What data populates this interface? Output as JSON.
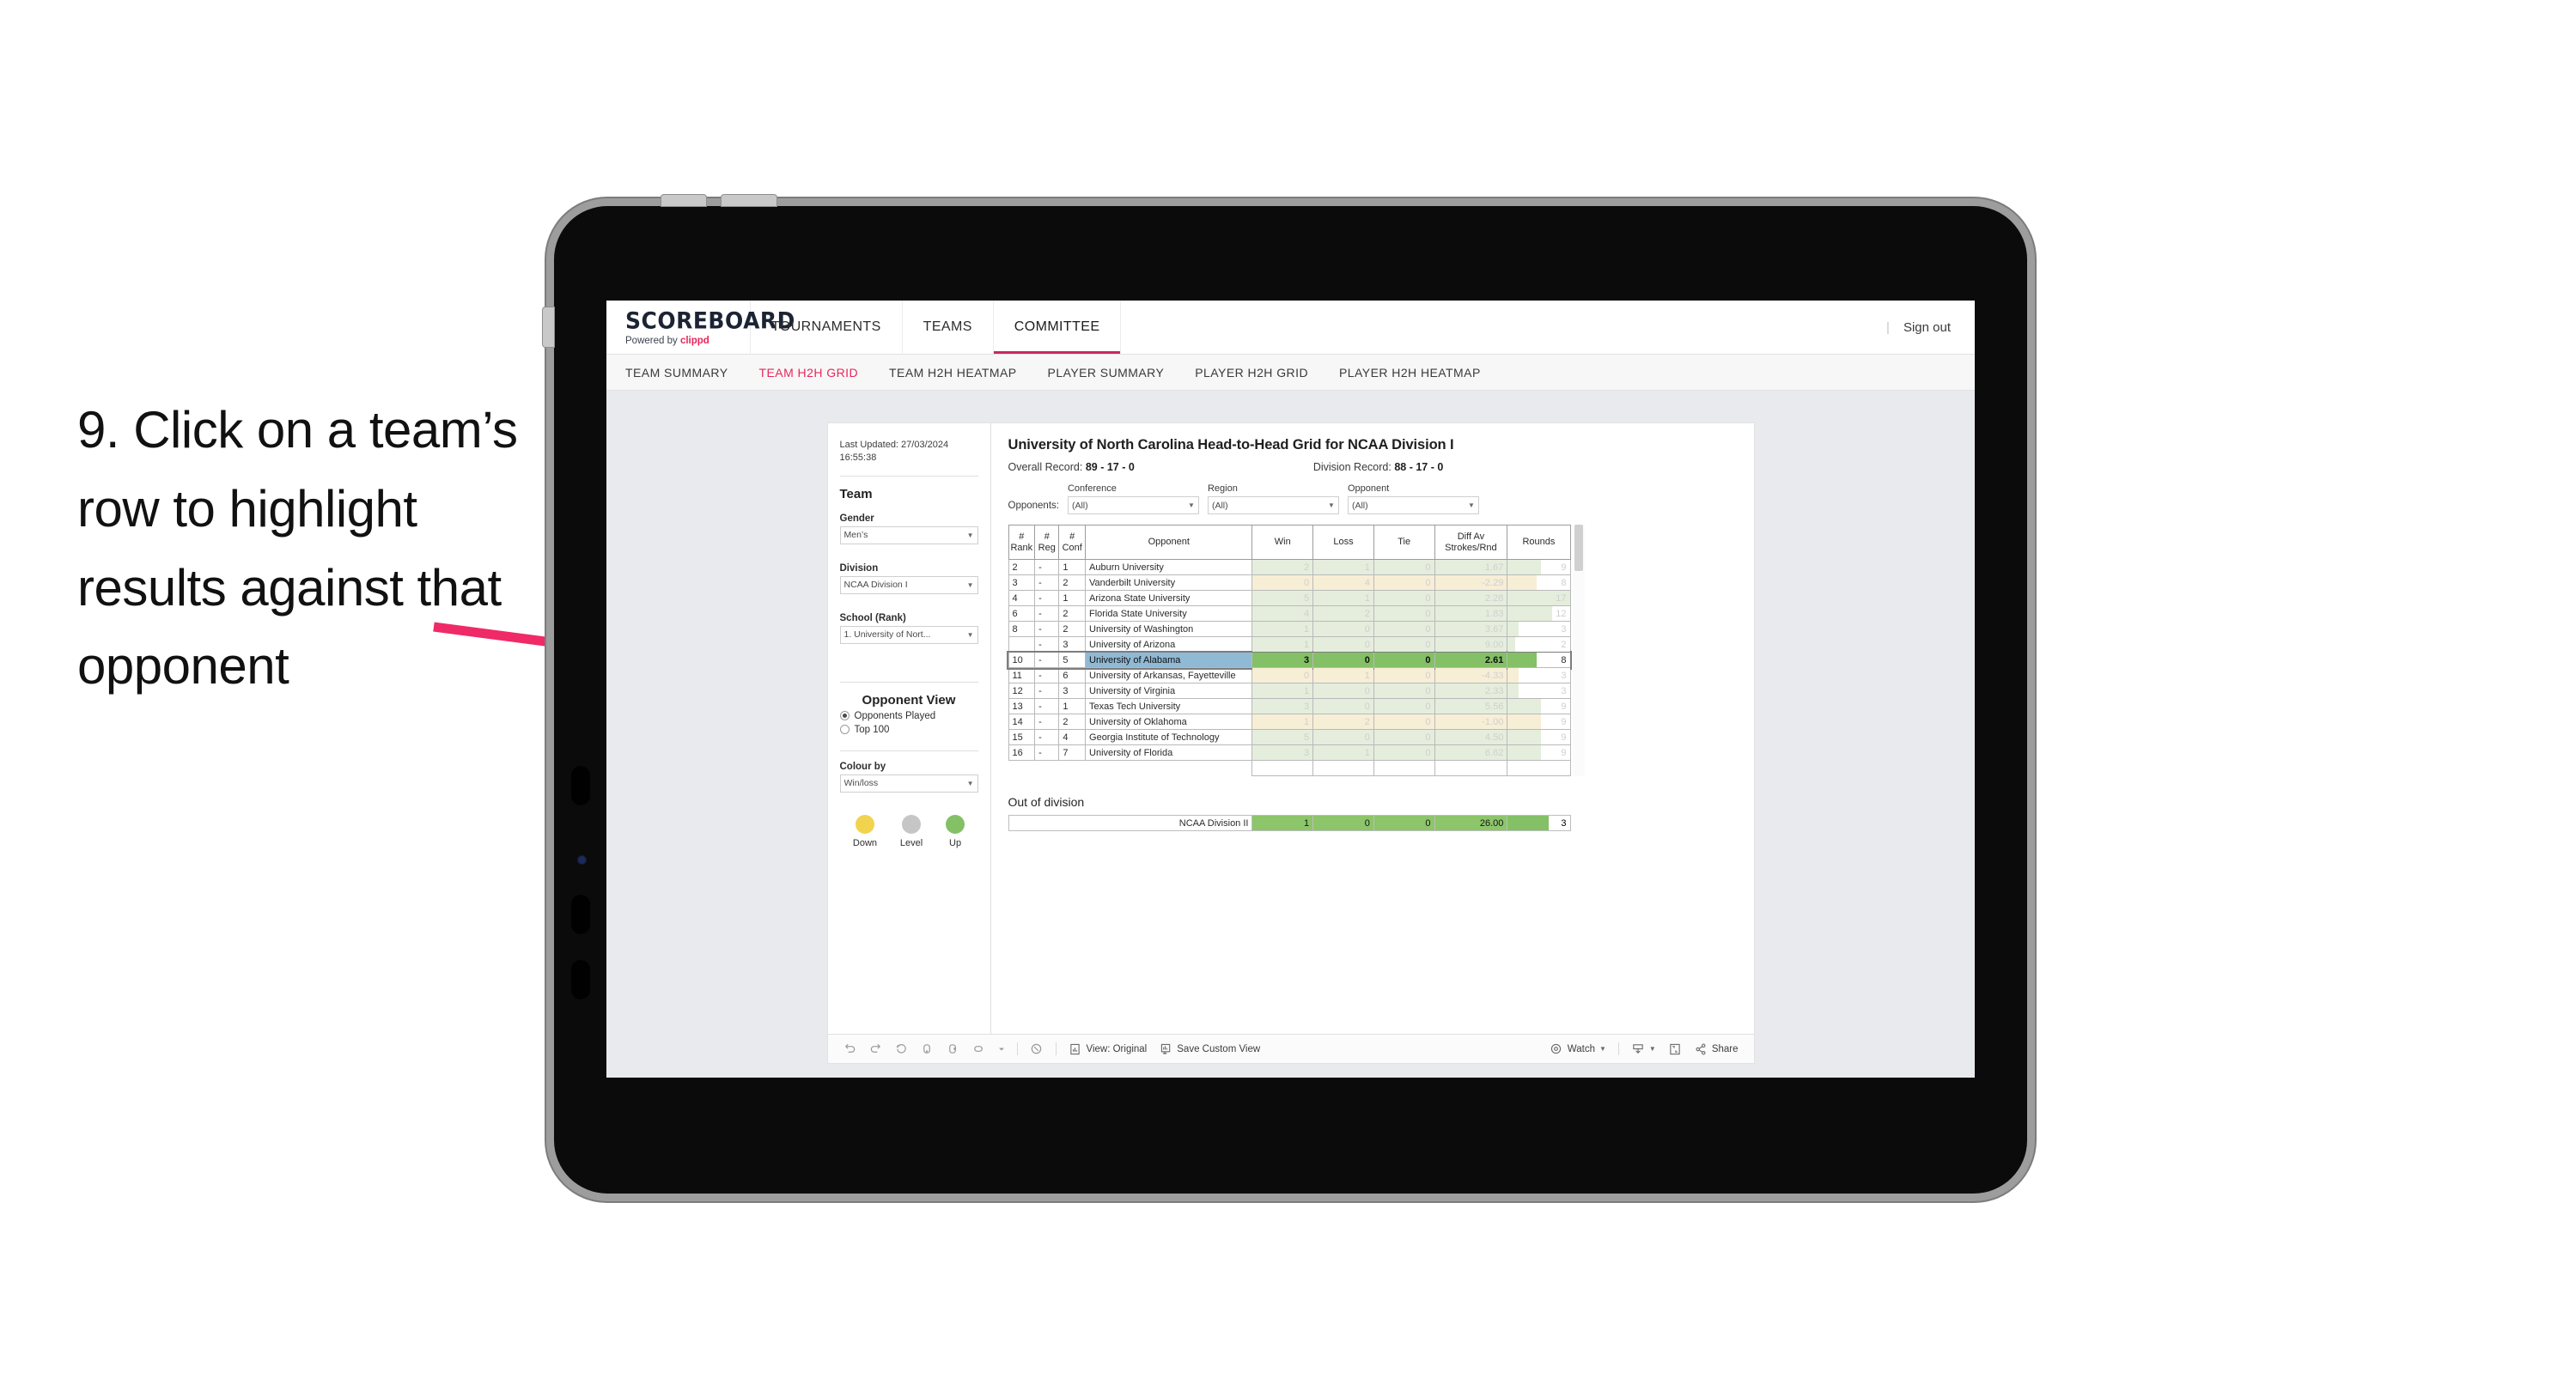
{
  "instruction": {
    "text": "9. Click on a team’s row to highlight results against that opponent"
  },
  "appbar": {
    "brand_title": "SCOREBOARD",
    "brand_sub_prefix": "Powered by ",
    "brand_sub_brand": "clippd",
    "tabs": [
      {
        "label": "TOURNAMENTS",
        "active": false
      },
      {
        "label": "TEAMS",
        "active": false
      },
      {
        "label": "COMMITTEE",
        "active": true
      }
    ],
    "divider": "|",
    "signout": "Sign out"
  },
  "subtabs": [
    {
      "label": "TEAM SUMMARY",
      "active": false
    },
    {
      "label": "TEAM H2H GRID",
      "active": true
    },
    {
      "label": "TEAM H2H HEATMAP",
      "active": false
    },
    {
      "label": "PLAYER SUMMARY",
      "active": false
    },
    {
      "label": "PLAYER H2H GRID",
      "active": false
    },
    {
      "label": "PLAYER H2H HEATMAP",
      "active": false
    }
  ],
  "sidebar": {
    "last_updated": "Last Updated: 27/03/2024 16:55:38",
    "team_heading": "Team",
    "gender_label": "Gender",
    "gender_value": "Men’s",
    "division_label": "Division",
    "division_value": "NCAA Division I",
    "school_label": "School (Rank)",
    "school_value": "1. University of Nort...",
    "opponent_view_heading": "Opponent View",
    "radio_options": [
      {
        "label": "Opponents Played",
        "selected": true
      },
      {
        "label": "Top 100",
        "selected": false
      }
    ],
    "colour_by_label": "Colour by",
    "colour_by_value": "Win/loss",
    "legend": [
      {
        "label": "Down",
        "color": "#f2d34e"
      },
      {
        "label": "Level",
        "color": "#c6c6c6"
      },
      {
        "label": "Up",
        "color": "#84c066"
      }
    ]
  },
  "main": {
    "title": "University of North Carolina Head-to-Head Grid for NCAA Division I",
    "overall_record_label": "Overall Record:",
    "overall_record_value": "89 - 17 - 0",
    "division_record_label": "Division Record:",
    "division_record_value": "88 - 17 - 0",
    "filters_prefix": "Opponents:",
    "filters": [
      {
        "label": "Conference",
        "value": "(All)"
      },
      {
        "label": "Region",
        "value": "(All)"
      },
      {
        "label": "Opponent",
        "value": "(All)"
      }
    ],
    "out_of_division_heading": "Out of division"
  },
  "chart_data": {
    "type": "table",
    "title": "University of North Carolina Head-to-Head Grid for NCAA Division I",
    "columns": [
      "# Rank",
      "# Reg",
      "# Conf",
      "Opponent",
      "Win",
      "Loss",
      "Tie",
      "Diff Av Strokes/Rnd",
      "Rounds"
    ],
    "column_header_lines": [
      [
        "#",
        "Rank"
      ],
      [
        "#",
        "Reg"
      ],
      [
        "#",
        "Conf"
      ],
      [
        "Opponent"
      ],
      [
        "Win"
      ],
      [
        "Loss"
      ],
      [
        "Tie"
      ],
      [
        "Diff Av",
        "Strokes/Rnd"
      ],
      [
        "Rounds"
      ]
    ],
    "rows": [
      {
        "rank": "2",
        "reg": "-",
        "conf": "1",
        "opponent": "Auburn University",
        "win": "2",
        "loss": "1",
        "tie": "0",
        "diff": "1.67",
        "rounds": "9",
        "state": "up",
        "bar_pct": 53
      },
      {
        "rank": "3",
        "reg": "-",
        "conf": "2",
        "opponent": "Vanderbilt University",
        "win": "0",
        "loss": "4",
        "tie": "0",
        "diff": "-2.29",
        "rounds": "8",
        "state": "down",
        "bar_pct": 47
      },
      {
        "rank": "4",
        "reg": "-",
        "conf": "1",
        "opponent": "Arizona State University",
        "win": "5",
        "loss": "1",
        "tie": "0",
        "diff": "2.28",
        "rounds": "17",
        "state": "up",
        "bar_pct": 100
      },
      {
        "rank": "6",
        "reg": "-",
        "conf": "2",
        "opponent": "Florida State University",
        "win": "4",
        "loss": "2",
        "tie": "0",
        "diff": "1.83",
        "rounds": "12",
        "state": "up",
        "bar_pct": 71
      },
      {
        "rank": "8",
        "reg": "-",
        "conf": "2",
        "opponent": "University of Washington",
        "win": "1",
        "loss": "0",
        "tie": "0",
        "diff": "3.67",
        "rounds": "3",
        "state": "up",
        "bar_pct": 18
      },
      {
        "rank": "",
        "reg": "-",
        "conf": "3",
        "opponent": "University of Arizona",
        "win": "1",
        "loss": "0",
        "tie": "0",
        "diff": "9.00",
        "rounds": "2",
        "state": "up",
        "bar_pct": 12
      },
      {
        "rank": "10",
        "reg": "-",
        "conf": "5",
        "opponent": "University of Alabama",
        "win": "3",
        "loss": "0",
        "tie": "0",
        "diff": "2.61",
        "rounds": "8",
        "state": "selected",
        "bar_pct": 47
      },
      {
        "rank": "11",
        "reg": "-",
        "conf": "6",
        "opponent": "University of Arkansas, Fayetteville",
        "win": "0",
        "loss": "1",
        "tie": "0",
        "diff": "-4.33",
        "rounds": "3",
        "state": "down",
        "bar_pct": 18
      },
      {
        "rank": "12",
        "reg": "-",
        "conf": "3",
        "opponent": "University of Virginia",
        "win": "1",
        "loss": "0",
        "tie": "0",
        "diff": "2.33",
        "rounds": "3",
        "state": "up",
        "bar_pct": 18
      },
      {
        "rank": "13",
        "reg": "-",
        "conf": "1",
        "opponent": "Texas Tech University",
        "win": "3",
        "loss": "0",
        "tie": "0",
        "diff": "5.56",
        "rounds": "9",
        "state": "up",
        "bar_pct": 53
      },
      {
        "rank": "14",
        "reg": "-",
        "conf": "2",
        "opponent": "University of Oklahoma",
        "win": "1",
        "loss": "2",
        "tie": "0",
        "diff": "-1.00",
        "rounds": "9",
        "state": "down",
        "bar_pct": 53
      },
      {
        "rank": "15",
        "reg": "-",
        "conf": "4",
        "opponent": "Georgia Institute of Technology",
        "win": "5",
        "loss": "0",
        "tie": "0",
        "diff": "4.50",
        "rounds": "9",
        "state": "up",
        "bar_pct": 53
      },
      {
        "rank": "16",
        "reg": "-",
        "conf": "7",
        "opponent": "University of Florida",
        "win": "3",
        "loss": "1",
        "tie": "0",
        "diff": "6.62",
        "rounds": "9",
        "state": "up",
        "bar_pct": 53
      }
    ],
    "out_of_division": {
      "label": "NCAA Division II",
      "win": "1",
      "loss": "0",
      "tie": "0",
      "diff": "26.00",
      "rounds": "3"
    },
    "selected_row_opponent": "University of Alabama",
    "legend": [
      {
        "label": "Down",
        "color": "#f2d34e"
      },
      {
        "label": "Level",
        "color": "#c6c6c6"
      },
      {
        "label": "Up",
        "color": "#84c066"
      }
    ]
  },
  "toolbar": {
    "view_label": "View: Original",
    "save_label": "Save Custom View",
    "watch_label": "Watch",
    "share_label": "Share"
  }
}
